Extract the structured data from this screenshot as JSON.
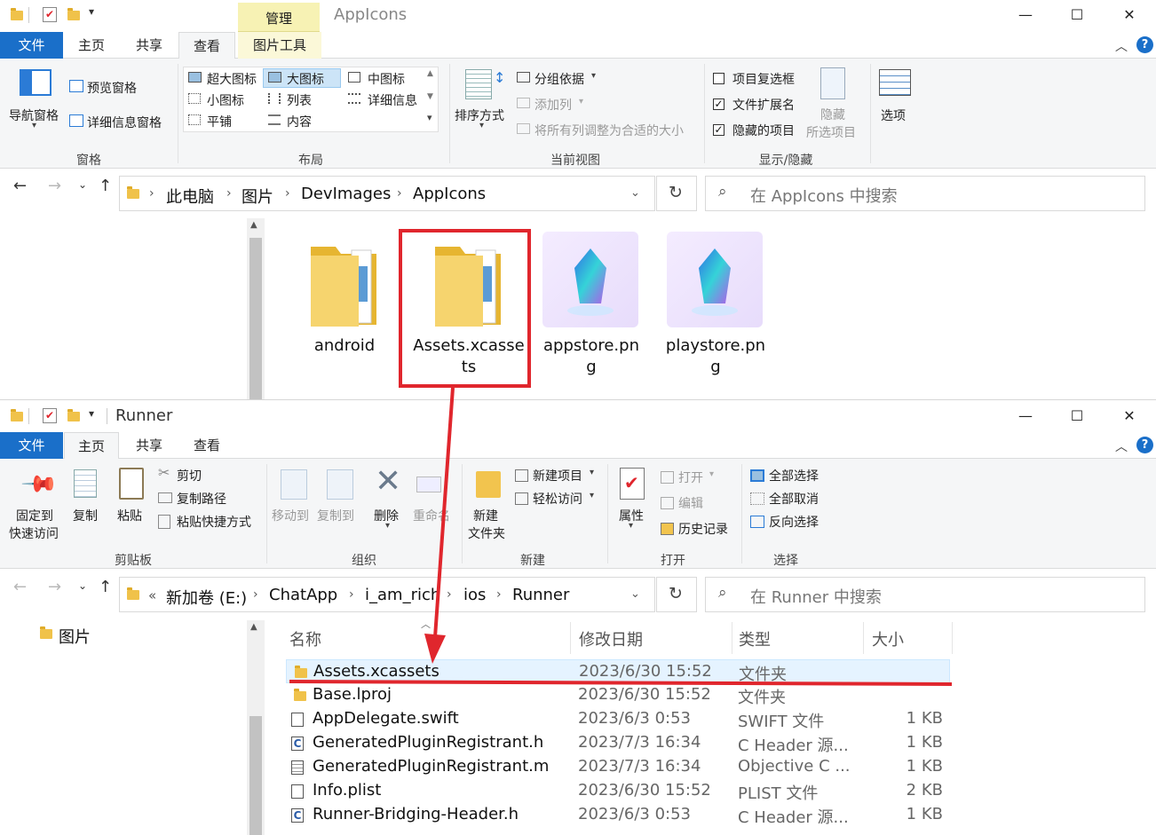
{
  "window_top": {
    "title": "AppIcons",
    "context_tab": "管理",
    "tabs": [
      "文件",
      "主页",
      "共享",
      "查看",
      "图片工具"
    ],
    "active_tab": "查看",
    "ribbon": {
      "pane_group": {
        "nav_pane": "导航窗格",
        "preview_pane": "预览窗格",
        "details_pane": "详细信息窗格",
        "label": "窗格"
      },
      "layout_group": {
        "items": [
          "超大图标",
          "大图标",
          "中图标",
          "小图标",
          "列表",
          "详细信息",
          "平铺",
          "内容"
        ],
        "selected": "大图标",
        "label": "布局"
      },
      "current_view_group": {
        "sort": "排序方式",
        "group_by": "分组依据",
        "add_column": "添加列",
        "fit_columns": "将所有列调整为合适的大小",
        "label": "当前视图"
      },
      "show_hide_group": {
        "item_checkboxes": "项目复选框",
        "item_checkboxes_checked": false,
        "file_ext": "文件扩展名",
        "file_ext_checked": true,
        "hidden_items": "隐藏的项目",
        "hidden_items_checked": true,
        "hide_selected": "隐藏",
        "hide_selected2": "所选项目",
        "label": "显示/隐藏"
      },
      "options": "选项"
    },
    "address": {
      "crumbs": [
        "此电脑",
        "图片",
        "DevImages",
        "AppIcons"
      ]
    },
    "search_placeholder": "在 AppIcons 中搜索",
    "items": [
      {
        "name1": "android",
        "name2": "",
        "kind": "folder"
      },
      {
        "name1": "Assets.xcasse",
        "name2": "ts",
        "kind": "folder"
      },
      {
        "name1": "appstore.pn",
        "name2": "g",
        "kind": "image"
      },
      {
        "name1": "playstore.pn",
        "name2": "g",
        "kind": "image"
      }
    ]
  },
  "window_bottom": {
    "title": "Runner",
    "tabs": [
      "文件",
      "主页",
      "共享",
      "查看"
    ],
    "active_tab": "主页",
    "ribbon": {
      "clipboard": {
        "pin1": "固定到",
        "pin2": "快速访问",
        "copy": "复制",
        "paste": "粘贴",
        "cut": "剪切",
        "copy_path": "复制路径",
        "paste_shortcut": "粘贴快捷方式",
        "label": "剪贴板"
      },
      "organize": {
        "move_to": "移动到",
        "copy_to": "复制到",
        "delete": "删除",
        "rename": "重命名",
        "label": "组织"
      },
      "new": {
        "new_folder1": "新建",
        "new_folder2": "文件夹",
        "new_item": "新建项目",
        "easy_access": "轻松访问",
        "label": "新建"
      },
      "open": {
        "properties": "属性",
        "open": "打开",
        "edit": "编辑",
        "history": "历史记录",
        "label": "打开"
      },
      "select": {
        "select_all": "全部选择",
        "select_none": "全部取消",
        "invert": "反向选择",
        "label": "选择"
      }
    },
    "address": {
      "prefix": "«",
      "crumbs": [
        "新加卷 (E:)",
        "ChatApp",
        "i_am_rich",
        "ios",
        "Runner"
      ]
    },
    "search_placeholder": "在 Runner 中搜索",
    "nav_item": "图片",
    "columns": [
      "名称",
      "修改日期",
      "类型",
      "大小"
    ],
    "rows": [
      {
        "name": "Assets.xcassets",
        "date": "2023/6/30 15:52",
        "type": "文件夹",
        "size": "",
        "icon": "folder"
      },
      {
        "name": "Base.lproj",
        "date": "2023/6/30 15:52",
        "type": "文件夹",
        "size": "",
        "icon": "folder"
      },
      {
        "name": "AppDelegate.swift",
        "date": "2023/6/3 0:53",
        "type": "SWIFT 文件",
        "size": "1 KB",
        "icon": "file"
      },
      {
        "name": "GeneratedPluginRegistrant.h",
        "date": "2023/7/3 16:34",
        "type": "C Header 源...",
        "size": "1 KB",
        "icon": "c-file"
      },
      {
        "name": "GeneratedPluginRegistrant.m",
        "date": "2023/7/3 16:34",
        "type": "Objective C ...",
        "size": "1 KB",
        "icon": "file"
      },
      {
        "name": "Info.plist",
        "date": "2023/6/30 15:52",
        "type": "PLIST 文件",
        "size": "2 KB",
        "icon": "file"
      },
      {
        "name": "Runner-Bridging-Header.h",
        "date": "2023/6/3 0:53",
        "type": "C Header 源...",
        "size": "1 KB",
        "icon": "c-file"
      }
    ]
  },
  "colors": {
    "file_tab": "#1a6fc9",
    "annotation": "#e0262d",
    "ribbon_bg": "#f5f6f7",
    "folder": "#f0c24a"
  }
}
